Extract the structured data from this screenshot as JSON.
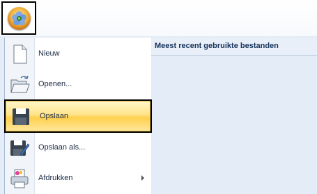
{
  "menu": {
    "items": [
      {
        "label": "Nieuw",
        "icon": "new-document-icon"
      },
      {
        "label": "Openen...",
        "icon": "open-folder-icon"
      },
      {
        "label": "Opslaan",
        "icon": "save-icon",
        "state": "highlighted"
      },
      {
        "label": "Opslaan als...",
        "icon": "save-as-icon"
      },
      {
        "label": "Afdrukken",
        "icon": "print-icon",
        "has_submenu": true
      }
    ]
  },
  "recent": {
    "header": "Meest recent gebruikte bestanden"
  },
  "colors": {
    "highlight": "#ffd04d",
    "menu_background": "#e4ecf7",
    "header_text": "#15325c"
  }
}
